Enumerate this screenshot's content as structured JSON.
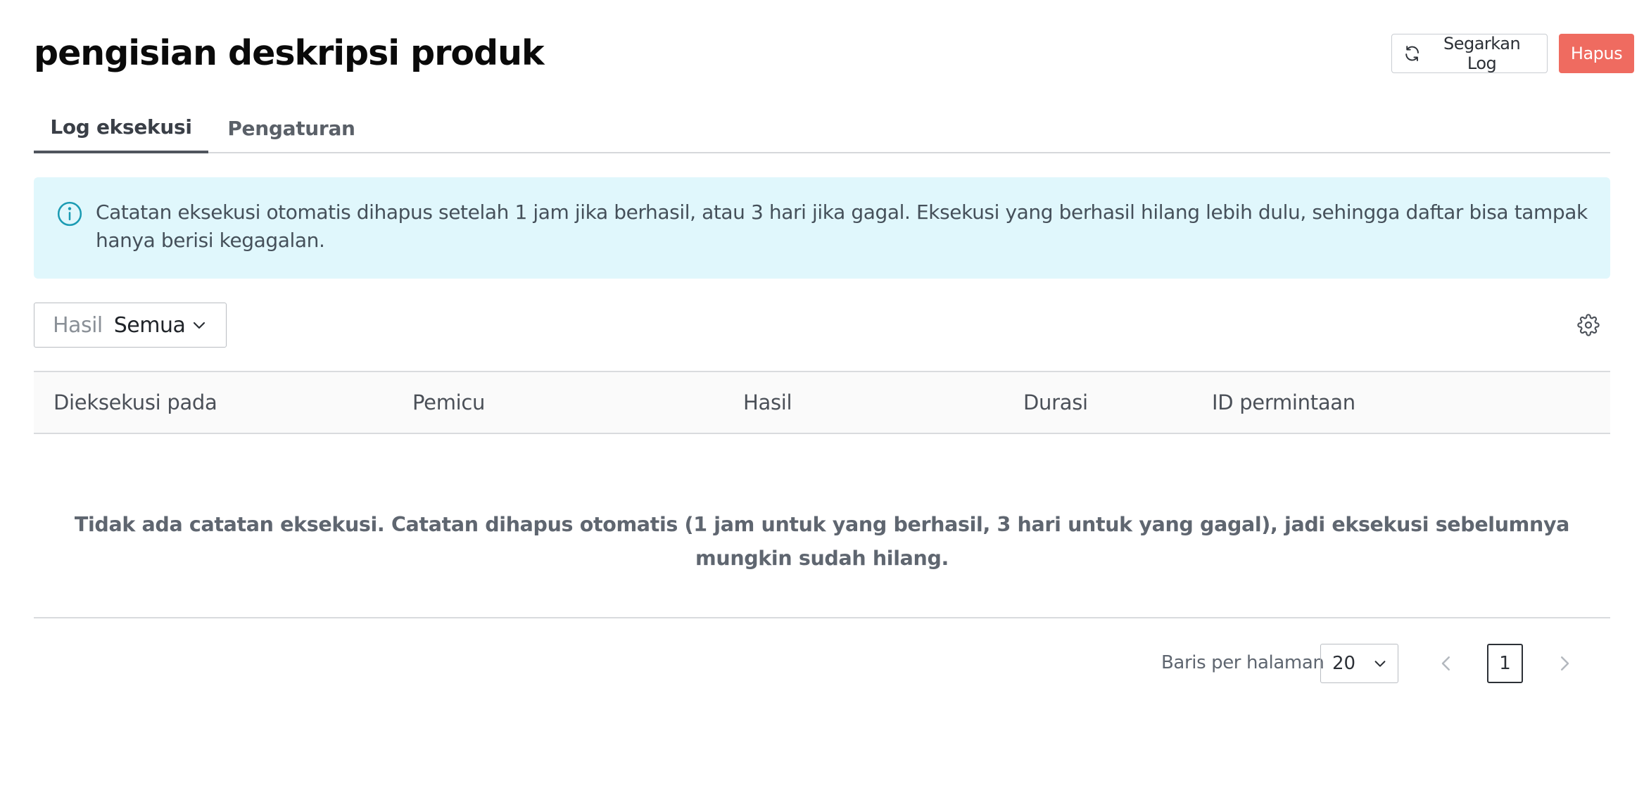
{
  "header": {
    "title": "pengisian deskripsi produk",
    "refresh_label": "Segarkan Log",
    "delete_label": "Hapus"
  },
  "tabs": [
    {
      "label": "Log eksekusi",
      "active": true
    },
    {
      "label": "Pengaturan",
      "active": false
    }
  ],
  "info_banner": {
    "icon": "info-icon",
    "text": "Catatan eksekusi otomatis dihapus setelah 1 jam jika berhasil, atau 3 hari jika gagal. Eksekusi yang berhasil hilang lebih dulu, sehingga daftar bisa tampak hanya berisi kegagalan."
  },
  "filter": {
    "label": "Hasil",
    "value": "Semua"
  },
  "table": {
    "columns": [
      "Dieksekusi pada",
      "Pemicu",
      "Hasil",
      "Durasi",
      "ID permintaan"
    ],
    "empty_message": "Tidak ada catatan eksekusi. Catatan dihapus otomatis (1 jam untuk yang berhasil, 3 hari untuk yang gagal), jadi eksekusi sebelumnya mungkin sudah hilang."
  },
  "pagination": {
    "rows_label": "Baris per halaman",
    "rows_value": "20",
    "current_page": "1"
  },
  "colors": {
    "delete_button": "#ef6b60",
    "info_background": "#e0f7fc",
    "info_icon": "#1b9bb3"
  }
}
